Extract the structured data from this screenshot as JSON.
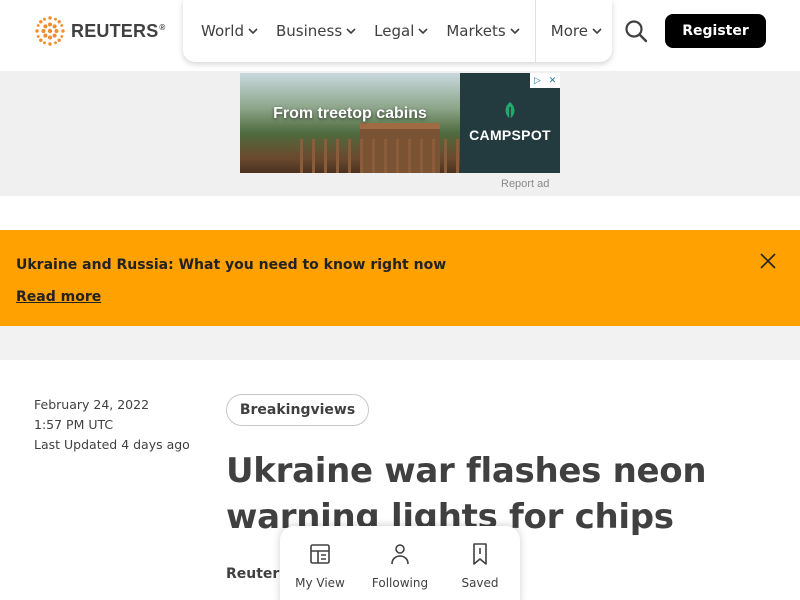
{
  "header": {
    "logo_text": "REUTERS",
    "logo_reg": "®",
    "nav": [
      {
        "label": "World"
      },
      {
        "label": "Business"
      },
      {
        "label": "Legal"
      },
      {
        "label": "Markets"
      }
    ],
    "more_label": "More",
    "register_label": "Register"
  },
  "ad": {
    "headline": "From treetop cabins",
    "brand": "CAMPSPOT",
    "report_label": "Report ad"
  },
  "banner": {
    "title": "Ukraine and Russia: What you need to know right now",
    "link": "Read more"
  },
  "article": {
    "date": "February 24, 2022",
    "time": "1:57 PM UTC",
    "updated": "Last Updated 4 days ago",
    "tag": "Breakingviews",
    "headline": "Ukraine war flashes neon warning lights for chips",
    "byline": "Reuters"
  },
  "bottom_bar": {
    "items": [
      {
        "label": "My View",
        "icon": "layout-icon"
      },
      {
        "label": "Following",
        "icon": "person-icon"
      },
      {
        "label": "Saved",
        "icon": "bookmark-icon"
      }
    ]
  },
  "colors": {
    "banner": "#ffa100",
    "logo_orange": "#f28c28",
    "ad_brand_bg": "#233a3f",
    "ad_brand_green": "#1faa6b"
  }
}
